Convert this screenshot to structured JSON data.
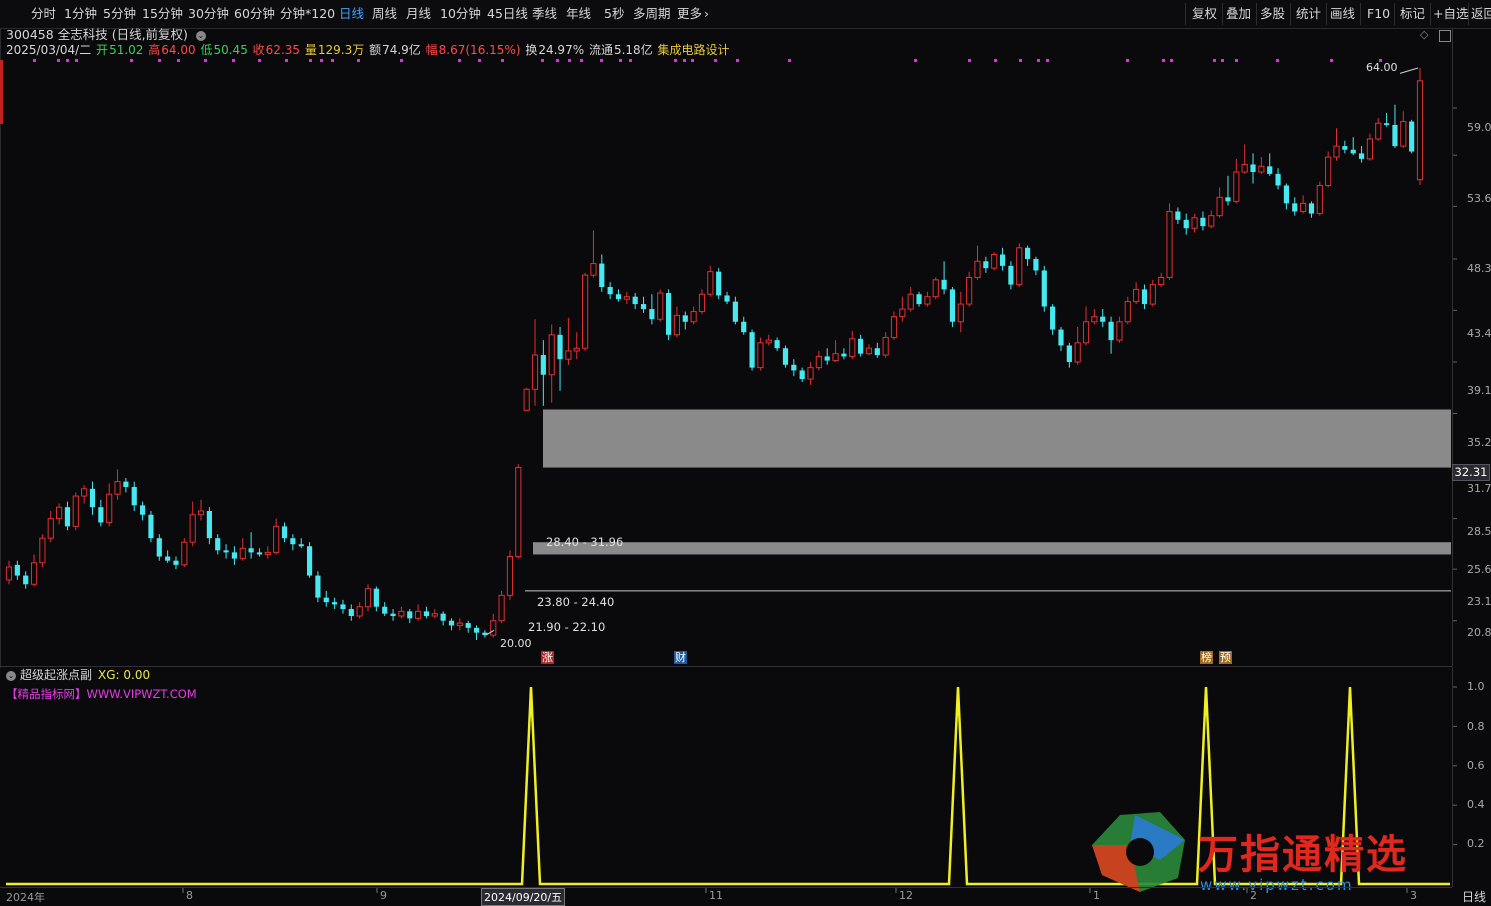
{
  "toolbar": {
    "periods": [
      "分时",
      "1分钟",
      "5分钟",
      "15分钟",
      "30分钟",
      "60分钟",
      "分钟*120",
      "日线",
      "周线",
      "月线",
      "10分钟",
      "45日线",
      "季线",
      "年线",
      "5秒",
      "多周期",
      "更多"
    ],
    "active_period": "日线",
    "right_items": [
      "复权",
      "叠加",
      "多股",
      "统计",
      "画线",
      "F10",
      "标记",
      "+自选",
      "返回"
    ]
  },
  "stock": {
    "code_name": "300458 全志科技",
    "mode": "(日线,前复权)",
    "date": "2025/03/04/二",
    "open_label": "开",
    "open": "51.02",
    "high_label": "高",
    "high": "64.00",
    "low_label": "低",
    "low": "50.45",
    "close_label": "收",
    "close": "62.35",
    "volume_label": "量",
    "volume": "129.3万",
    "amount_label": "额",
    "amount": "74.9亿",
    "range_label": "幅",
    "range": "8.67(16.15%)",
    "turnover_label": "换",
    "turnover": "24.97%",
    "float_label": "流通",
    "float": "5.18亿",
    "concept": "集成电路设计"
  },
  "price_axis": {
    "labels": [
      "59.0",
      "53.6",
      "48.3",
      "43.4",
      "39.1",
      "35.2",
      "31.7",
      "28.5",
      "25.6",
      "23.1",
      "20.8"
    ],
    "current_price": "32.31"
  },
  "annotations": {
    "high_marker": "64.00",
    "low_marker": "20.00",
    "zone_upper": "28.40 - 31.96",
    "zone_middle": "23.80 - 24.40",
    "zone_lower": "21.90 - 22.10"
  },
  "event_tags": [
    {
      "text": "涨",
      "color": "#b02828"
    },
    {
      "text": "财",
      "color": "#1e5aa0"
    },
    {
      "text": "榜",
      "color": "#a06818"
    },
    {
      "text": "预",
      "color": "#a06818"
    }
  ],
  "sub_panel": {
    "title": "超级起涨点副",
    "xg_label": "XG: 0.00",
    "site": "【精品指标网】WWW.VIPWZT.COM",
    "axis_labels": [
      "1.0",
      "0.8",
      "0.6",
      "0.4",
      "0.2"
    ]
  },
  "date_axis": {
    "labels": [
      "2024年",
      "8",
      "9",
      "2024/09/20/五",
      "11",
      "12",
      "1",
      "2",
      "3"
    ],
    "period": "日线"
  },
  "watermark": {
    "title": "万指通精选",
    "url": "www.vipwzt.com"
  },
  "colors": {
    "up": "#e03030",
    "down": "#48e8f0",
    "signal": "#f0f020",
    "marker": "#e030e0",
    "zone": "#8a8a8a"
  },
  "chart_data": {
    "type": "candlestick",
    "ylim": [
      20.0,
      64.0
    ],
    "signal": {
      "name": "XG",
      "ylim": [
        0,
        1
      ],
      "peaks_at_date": [
        "2024/09/20/五"
      ],
      "peak_value": 1.0,
      "peak_count": 4
    },
    "candles": [
      [
        22.6,
        23.2,
        22.4,
        23.5
      ],
      [
        23.3,
        22.8,
        22.6,
        23.5
      ],
      [
        22.8,
        22.4,
        22.2,
        23.0
      ],
      [
        22.4,
        23.4,
        22.3,
        23.8
      ],
      [
        23.4,
        24.6,
        23.2,
        24.8
      ],
      [
        24.6,
        25.6,
        24.4,
        26.0
      ],
      [
        25.6,
        26.2,
        25.3,
        26.4
      ],
      [
        26.2,
        25.2,
        25.0,
        26.5
      ],
      [
        25.2,
        26.8,
        25.0,
        27.0
      ],
      [
        26.8,
        27.2,
        26.4,
        27.4
      ],
      [
        27.2,
        26.2,
        25.8,
        27.6
      ],
      [
        26.2,
        25.4,
        25.2,
        26.6
      ],
      [
        25.4,
        26.9,
        25.2,
        27.5
      ],
      [
        26.9,
        27.6,
        26.6,
        28.3
      ],
      [
        27.6,
        27.3,
        27.0,
        27.8
      ],
      [
        27.3,
        26.3,
        26.0,
        27.6
      ],
      [
        26.3,
        25.8,
        25.5,
        26.5
      ],
      [
        25.8,
        24.6,
        24.4,
        26.0
      ],
      [
        24.6,
        23.7,
        23.5,
        24.8
      ],
      [
        23.7,
        23.5,
        23.4,
        24.0
      ],
      [
        23.5,
        23.3,
        23.1,
        23.7
      ],
      [
        23.3,
        24.4,
        23.2,
        24.6
      ],
      [
        24.4,
        25.8,
        24.2,
        26.5
      ],
      [
        25.8,
        26.0,
        25.5,
        26.6
      ],
      [
        26.0,
        24.6,
        24.3,
        26.2
      ],
      [
        24.6,
        24.0,
        23.8,
        24.8
      ],
      [
        24.0,
        23.9,
        23.6,
        24.3
      ],
      [
        23.9,
        23.6,
        23.3,
        24.2
      ],
      [
        23.6,
        24.1,
        23.5,
        24.6
      ],
      [
        24.1,
        23.9,
        23.6,
        24.9
      ],
      [
        23.9,
        23.8,
        23.7,
        24.1
      ],
      [
        23.8,
        23.9,
        23.6,
        24.2
      ],
      [
        23.9,
        25.2,
        23.8,
        25.6
      ],
      [
        25.2,
        24.6,
        24.4,
        25.4
      ],
      [
        24.6,
        24.3,
        24.0,
        24.8
      ],
      [
        24.3,
        24.2,
        24.1,
        24.6
      ],
      [
        24.2,
        22.8,
        22.7,
        24.4
      ],
      [
        22.8,
        21.8,
        21.6,
        23.0
      ],
      [
        21.8,
        21.6,
        21.4,
        22.1
      ],
      [
        21.6,
        21.5,
        21.3,
        21.8
      ],
      [
        21.5,
        21.3,
        21.1,
        21.7
      ],
      [
        21.3,
        21.0,
        20.8,
        21.5
      ],
      [
        21.0,
        21.4,
        20.9,
        21.6
      ],
      [
        21.4,
        22.2,
        21.2,
        22.4
      ],
      [
        22.2,
        21.4,
        21.2,
        22.3
      ],
      [
        21.4,
        21.1,
        21.0,
        21.6
      ],
      [
        21.1,
        21.0,
        20.8,
        21.3
      ],
      [
        21.0,
        21.2,
        20.9,
        21.4
      ],
      [
        21.2,
        20.9,
        20.7,
        21.3
      ],
      [
        20.9,
        21.2,
        20.8,
        21.5
      ],
      [
        21.2,
        21.0,
        20.9,
        21.4
      ],
      [
        21.0,
        21.1,
        20.9,
        21.3
      ],
      [
        21.1,
        20.8,
        20.6,
        21.2
      ],
      [
        20.8,
        20.6,
        20.4,
        20.9
      ],
      [
        20.6,
        20.7,
        20.4,
        20.9
      ],
      [
        20.7,
        20.5,
        20.3,
        20.8
      ],
      [
        20.5,
        20.3,
        20.0,
        20.6
      ],
      [
        20.3,
        20.2,
        20.1,
        20.4
      ],
      [
        20.2,
        20.8,
        20.1,
        21.1
      ],
      [
        20.8,
        21.9,
        20.7,
        22.1
      ],
      [
        21.9,
        23.7,
        21.7,
        24.0
      ],
      [
        23.7,
        28.4,
        23.6,
        28.6
      ],
      [
        31.9,
        33.3,
        33.3,
        33.4
      ],
      [
        33.3,
        35.7,
        32.2,
        38.4
      ],
      [
        35.7,
        34.3,
        32.2,
        36.8
      ],
      [
        34.3,
        37.2,
        32.4,
        38.0
      ],
      [
        37.2,
        35.4,
        33.2,
        37.8
      ],
      [
        35.4,
        36.0,
        35.0,
        38.5
      ],
      [
        36.0,
        36.2,
        35.4,
        37.4
      ],
      [
        36.2,
        42.0,
        36.0,
        42.2
      ],
      [
        42.0,
        43.0,
        41.8,
        46.0
      ],
      [
        43.0,
        41.0,
        40.6,
        43.8
      ],
      [
        41.0,
        40.4,
        40.0,
        41.4
      ],
      [
        40.4,
        40.0,
        39.8,
        40.8
      ],
      [
        40.0,
        40.2,
        39.6,
        40.6
      ],
      [
        40.2,
        39.6,
        39.2,
        40.5
      ],
      [
        39.6,
        39.2,
        38.9,
        40.2
      ],
      [
        39.2,
        38.4,
        38.0,
        40.4
      ],
      [
        38.4,
        40.5,
        38.2,
        40.8
      ],
      [
        40.5,
        37.2,
        36.8,
        40.8
      ],
      [
        37.2,
        38.7,
        37.0,
        39.4
      ],
      [
        38.7,
        38.2,
        37.6,
        39.0
      ],
      [
        38.2,
        39.0,
        38.0,
        39.4
      ],
      [
        39.0,
        40.4,
        38.8,
        40.8
      ],
      [
        40.4,
        42.3,
        40.2,
        42.8
      ],
      [
        42.3,
        40.3,
        40.0,
        42.6
      ],
      [
        40.3,
        39.8,
        39.6,
        40.6
      ],
      [
        39.8,
        38.2,
        38.0,
        40.2
      ],
      [
        38.2,
        37.4,
        37.2,
        38.6
      ],
      [
        37.4,
        34.8,
        34.6,
        37.6
      ],
      [
        34.8,
        36.6,
        34.6,
        37.0
      ],
      [
        36.6,
        36.8,
        36.4,
        37.2
      ],
      [
        36.8,
        36.2,
        36.0,
        37.0
      ],
      [
        36.2,
        35.0,
        34.8,
        36.4
      ],
      [
        35.0,
        34.6,
        34.2,
        35.4
      ],
      [
        34.6,
        34.0,
        33.8,
        34.8
      ],
      [
        34.0,
        34.8,
        33.6,
        35.2
      ],
      [
        34.8,
        35.6,
        34.6,
        36.0
      ],
      [
        35.6,
        35.3,
        35.0,
        36.2
      ],
      [
        35.3,
        35.8,
        35.2,
        36.8
      ],
      [
        35.8,
        35.6,
        35.4,
        36.2
      ],
      [
        35.6,
        36.9,
        35.4,
        37.5
      ],
      [
        36.9,
        35.8,
        35.6,
        37.2
      ],
      [
        35.8,
        36.2,
        35.7,
        36.5
      ],
      [
        36.2,
        35.7,
        35.5,
        36.6
      ],
      [
        35.7,
        37.0,
        35.5,
        37.4
      ],
      [
        37.0,
        38.6,
        36.8,
        39.0
      ],
      [
        38.6,
        39.2,
        38.2,
        40.2
      ],
      [
        39.2,
        40.4,
        39.0,
        41.0
      ],
      [
        40.4,
        39.6,
        39.4,
        40.6
      ],
      [
        39.6,
        40.2,
        39.4,
        40.6
      ],
      [
        40.2,
        41.6,
        40.0,
        41.8
      ],
      [
        41.6,
        40.8,
        40.4,
        43.2
      ],
      [
        40.8,
        38.2,
        37.8,
        41.0
      ],
      [
        38.2,
        39.6,
        37.4,
        40.6
      ],
      [
        39.6,
        41.8,
        39.4,
        42.3
      ],
      [
        41.8,
        43.2,
        41.6,
        44.6
      ],
      [
        43.2,
        42.6,
        42.2,
        43.6
      ],
      [
        42.6,
        43.8,
        42.4,
        44.0
      ],
      [
        43.8,
        42.8,
        42.4,
        44.4
      ],
      [
        42.8,
        41.2,
        40.8,
        43.2
      ],
      [
        41.2,
        44.4,
        41.0,
        44.8
      ],
      [
        44.4,
        43.4,
        42.8,
        44.6
      ],
      [
        43.4,
        42.4,
        42.0,
        43.6
      ],
      [
        42.4,
        39.4,
        39.0,
        42.8
      ],
      [
        39.4,
        37.6,
        37.2,
        39.6
      ],
      [
        37.6,
        36.4,
        36.0,
        37.8
      ],
      [
        36.4,
        35.2,
        34.8,
        36.6
      ],
      [
        35.2,
        36.6,
        35.0,
        37.8
      ],
      [
        36.6,
        38.2,
        36.4,
        39.4
      ],
      [
        38.2,
        38.6,
        38.0,
        39.2
      ],
      [
        38.6,
        38.2,
        37.8,
        39.2
      ],
      [
        38.2,
        36.8,
        35.8,
        38.6
      ],
      [
        36.8,
        38.2,
        36.6,
        38.6
      ],
      [
        38.2,
        39.8,
        38.0,
        40.2
      ],
      [
        39.8,
        40.8,
        39.6,
        41.4
      ],
      [
        40.8,
        39.6,
        39.2,
        41.2
      ],
      [
        39.6,
        41.2,
        39.4,
        41.6
      ],
      [
        41.2,
        41.8,
        41.0,
        42.2
      ],
      [
        41.8,
        47.8,
        41.6,
        48.6
      ],
      [
        47.8,
        47.0,
        46.6,
        48.2
      ],
      [
        47.0,
        46.2,
        45.6,
        47.6
      ],
      [
        46.2,
        47.2,
        45.8,
        47.6
      ],
      [
        47.2,
        46.4,
        46.0,
        47.8
      ],
      [
        46.4,
        47.4,
        46.2,
        47.9
      ],
      [
        47.4,
        49.2,
        47.2,
        50.2
      ],
      [
        49.2,
        48.8,
        48.4,
        51.4
      ],
      [
        48.8,
        51.8,
        48.6,
        53.2
      ],
      [
        51.8,
        52.6,
        51.6,
        54.8
      ],
      [
        52.6,
        51.8,
        50.6,
        53.8
      ],
      [
        51.8,
        52.4,
        51.6,
        53.4
      ],
      [
        52.4,
        51.6,
        51.4,
        53.8
      ],
      [
        51.6,
        50.4,
        50.0,
        52.2
      ],
      [
        50.4,
        48.6,
        48.0,
        50.6
      ],
      [
        48.6,
        47.8,
        47.4,
        49.2
      ],
      [
        47.8,
        48.6,
        47.6,
        49.4
      ],
      [
        48.6,
        47.6,
        47.2,
        48.8
      ],
      [
        47.6,
        50.4,
        47.4,
        50.8
      ],
      [
        50.4,
        53.4,
        50.2,
        54.0
      ],
      [
        53.4,
        54.6,
        53.0,
        56.6
      ],
      [
        54.6,
        54.2,
        53.8,
        55.2
      ],
      [
        54.2,
        53.8,
        53.6,
        55.6
      ],
      [
        53.8,
        53.2,
        52.8,
        54.6
      ],
      [
        53.2,
        55.4,
        53.0,
        56.0
      ],
      [
        55.4,
        57.2,
        55.2,
        57.8
      ],
      [
        57.2,
        57.0,
        56.8,
        58.4
      ],
      [
        57.0,
        54.6,
        54.4,
        59.4
      ],
      [
        54.6,
        57.4,
        54.4,
        58.6
      ],
      [
        57.4,
        54.0,
        53.8,
        57.6
      ],
      [
        51.0,
        62.35,
        50.45,
        64.0
      ]
    ]
  }
}
